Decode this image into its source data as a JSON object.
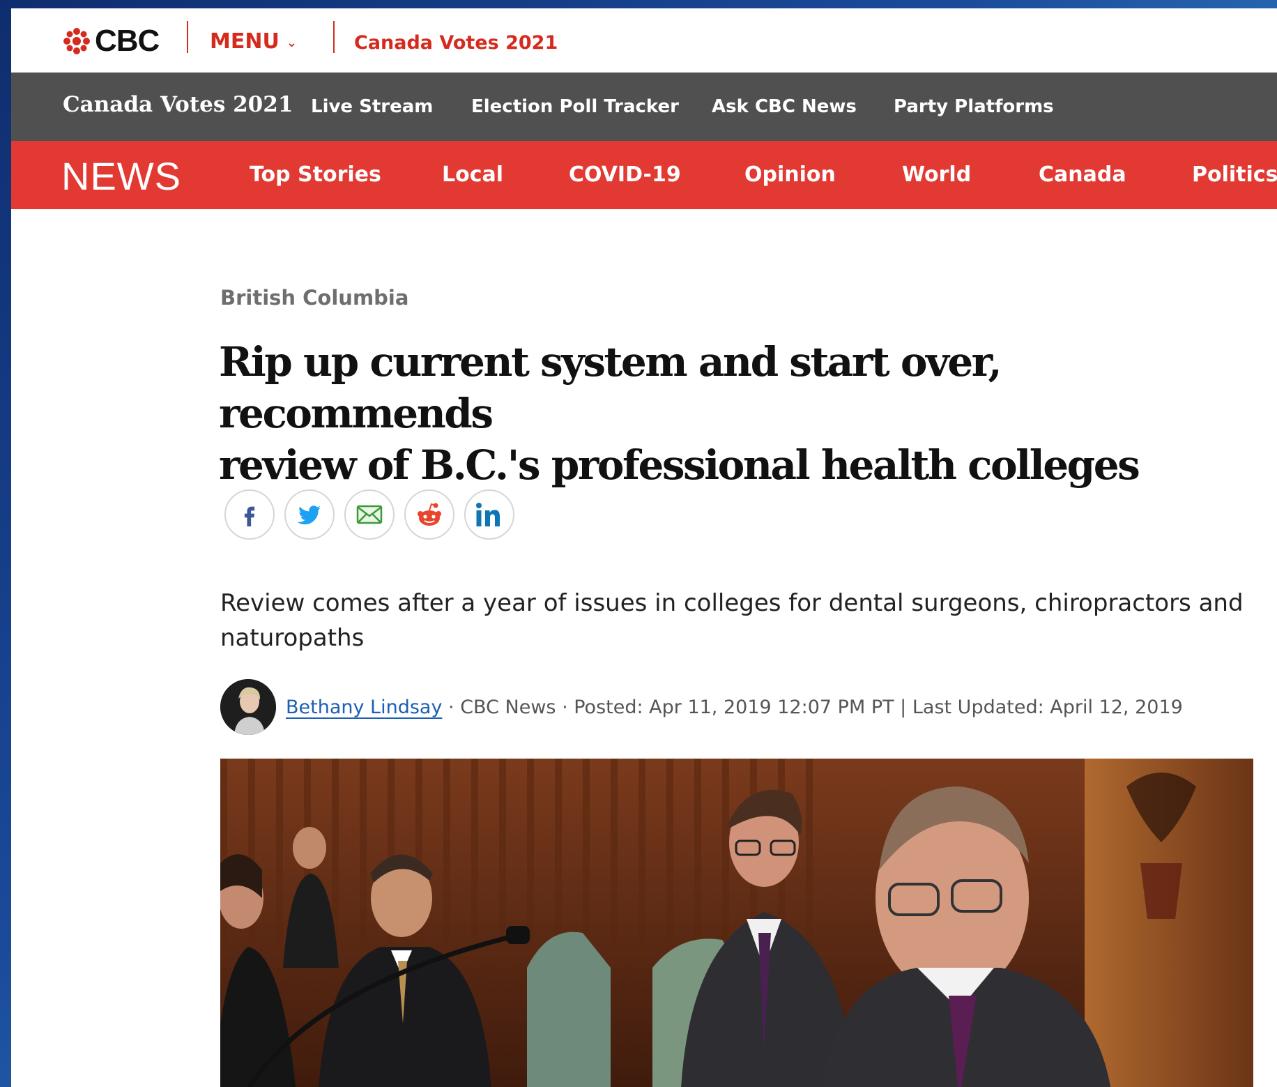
{
  "top_bar": {
    "logo_text": "CBC",
    "menu_label": "MENU",
    "election_link": "Canada Votes 2021"
  },
  "election_bar": {
    "brand": "Canada Votes 2021",
    "links": [
      "Live Stream",
      "Election Poll Tracker",
      "Ask CBC News",
      "Party Platforms"
    ]
  },
  "news_bar": {
    "brand": "NEWS",
    "links": [
      "Top Stories",
      "Local",
      "COVID-19",
      "Opinion",
      "World",
      "Canada",
      "Politics"
    ]
  },
  "article": {
    "section": "British Columbia",
    "headline_line1": "Rip up current system and start over, recommends",
    "headline_line2": "review of B.C.'s professional health colleges",
    "deck": "Review comes after a year of issues in colleges for dental surgeons, chiropractors and naturopaths",
    "byline": {
      "author": "Bethany Lindsay",
      "separator1": " · ",
      "outlet": "CBC News",
      "separator2": " · ",
      "posted": "Posted: Apr 11, 2019 12:07 PM PT",
      "separator3": " | ",
      "updated": "Last Updated: April 12, 2019"
    }
  },
  "share_buttons": [
    "facebook-icon",
    "twitter-icon",
    "email-icon",
    "reddit-icon",
    "linkedin-icon"
  ],
  "colors": {
    "brand_red": "#e23a33",
    "election_gray": "#505050",
    "link_blue": "#1d5fb4"
  }
}
